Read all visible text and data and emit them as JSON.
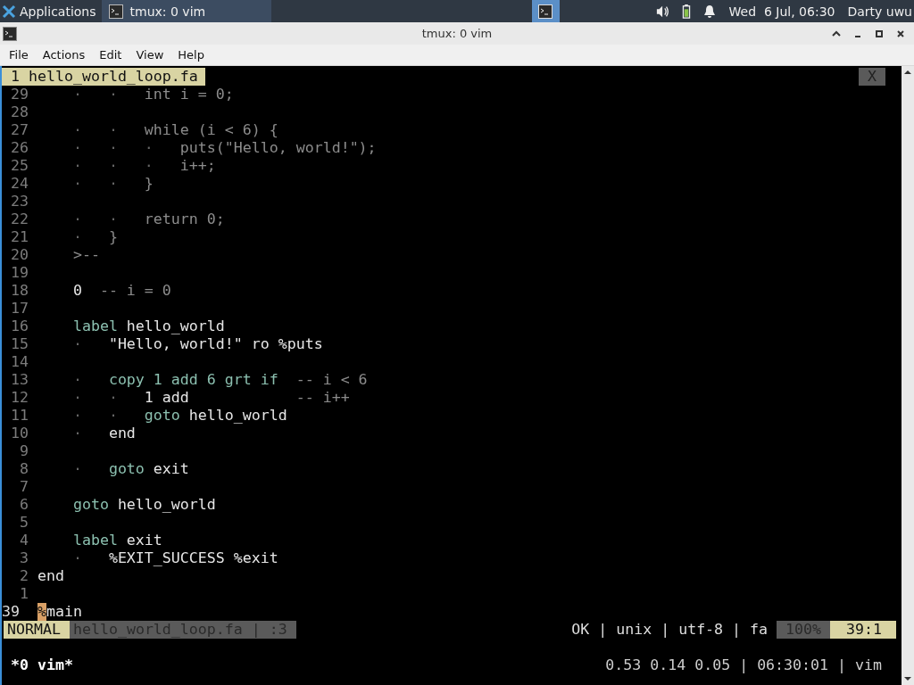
{
  "taskbar": {
    "menu_label": "Applications",
    "tasks": [
      {
        "title": "tmux: 0 vim",
        "selected": true
      }
    ],
    "clock": "Wed  6 Jul, 06:30",
    "user": "Darty uwu"
  },
  "window": {
    "title": "tmux: 0 vim"
  },
  "menu": [
    "File",
    "Actions",
    "Edit",
    "View",
    "Help"
  ],
  "vim": {
    "tabs": [
      {
        "label": "1 hello_world_loop.fa",
        "selected": true
      }
    ],
    "close_label": "X",
    "lines": [
      {
        "number": "29",
        "current": false,
        "segments": [
          {
            "kind": "guide",
            "text": "    ·   ·   "
          },
          {
            "kind": "dim",
            "text": "int i = 0;"
          }
        ]
      },
      {
        "number": "28",
        "current": false
      },
      {
        "number": "27",
        "current": false,
        "segments": [
          {
            "kind": "guide",
            "text": "    ·   ·   "
          },
          {
            "kind": "dim",
            "text": "while (i < 6) {"
          }
        ]
      },
      {
        "number": "26",
        "current": false,
        "segments": [
          {
            "kind": "guide",
            "text": "    ·   ·   ·   "
          },
          {
            "kind": "dim",
            "text": "puts(\"Hello, world!\");"
          }
        ]
      },
      {
        "number": "25",
        "current": false,
        "segments": [
          {
            "kind": "guide",
            "text": "    ·   ·   ·   "
          },
          {
            "kind": "dim",
            "text": "i++;"
          }
        ]
      },
      {
        "number": "24",
        "current": false,
        "segments": [
          {
            "kind": "guide",
            "text": "    ·   ·   "
          },
          {
            "kind": "dim",
            "text": "}"
          }
        ]
      },
      {
        "number": "23",
        "current": false
      },
      {
        "number": "22",
        "current": false,
        "segments": [
          {
            "kind": "guide",
            "text": "    ·   ·   "
          },
          {
            "kind": "dim",
            "text": "return 0;"
          }
        ]
      },
      {
        "number": "21",
        "current": false,
        "segments": [
          {
            "kind": "guide",
            "text": "    ·   "
          },
          {
            "kind": "dim",
            "text": "}"
          }
        ]
      },
      {
        "number": "20",
        "current": false,
        "segments": [
          {
            "kind": "dim",
            "text": "    >--"
          }
        ]
      },
      {
        "number": "19",
        "current": false
      },
      {
        "number": "18",
        "current": false,
        "segments": [
          {
            "kind": "plain",
            "text": "    0  "
          },
          {
            "kind": "dim",
            "text": "-- i = 0"
          }
        ]
      },
      {
        "number": "17",
        "current": false
      },
      {
        "number": "16",
        "current": false,
        "segments": [
          {
            "kind": "keyword",
            "text": "    label "
          },
          {
            "kind": "plain",
            "text": "hello_world"
          }
        ]
      },
      {
        "number": "15",
        "current": false,
        "segments": [
          {
            "kind": "guide",
            "text": "    ·   "
          },
          {
            "kind": "plain",
            "text": "\"Hello, world!\" ro %puts"
          }
        ]
      },
      {
        "number": "14",
        "current": false
      },
      {
        "number": "13",
        "current": false,
        "segments": [
          {
            "kind": "guide",
            "text": "    ·   "
          },
          {
            "kind": "keyword",
            "text": "copy 1 add 6 grt if  "
          },
          {
            "kind": "dim",
            "text": "-- i < 6"
          }
        ]
      },
      {
        "number": "12",
        "current": false,
        "segments": [
          {
            "kind": "guide",
            "text": "    ·   ·   "
          },
          {
            "kind": "plain",
            "text": "1 add            "
          },
          {
            "kind": "dim",
            "text": "-- i++"
          }
        ]
      },
      {
        "number": "11",
        "current": false,
        "segments": [
          {
            "kind": "guide",
            "text": "    ·   ·   "
          },
          {
            "kind": "keyword",
            "text": "goto "
          },
          {
            "kind": "plain",
            "text": "hello_world"
          }
        ]
      },
      {
        "number": "10",
        "current": false,
        "segments": [
          {
            "kind": "guide",
            "text": "    ·   "
          },
          {
            "kind": "plain",
            "text": "end"
          }
        ]
      },
      {
        "number": "9",
        "current": false
      },
      {
        "number": "8",
        "current": false,
        "segments": [
          {
            "kind": "guide",
            "text": "    ·   "
          },
          {
            "kind": "keyword",
            "text": "goto "
          },
          {
            "kind": "plain",
            "text": "exit"
          }
        ]
      },
      {
        "number": "7",
        "current": false
      },
      {
        "number": "6",
        "current": false,
        "segments": [
          {
            "kind": "keyword",
            "text": "    goto "
          },
          {
            "kind": "plain",
            "text": "hello_world"
          }
        ]
      },
      {
        "number": "5",
        "current": false
      },
      {
        "number": "4",
        "current": false,
        "segments": [
          {
            "kind": "keyword",
            "text": "    label "
          },
          {
            "kind": "plain",
            "text": "exit"
          }
        ]
      },
      {
        "number": "3",
        "current": false,
        "segments": [
          {
            "kind": "guide",
            "text": "    ·   "
          },
          {
            "kind": "plain",
            "text": "%EXIT_SUCCESS %exit"
          }
        ]
      },
      {
        "number": "2",
        "current": false,
        "segments": [
          {
            "kind": "plain",
            "text": "end"
          }
        ]
      },
      {
        "number": "1",
        "current": false
      },
      {
        "number": "39",
        "current": true,
        "segments": [
          {
            "kind": "cursor",
            "text": "%"
          },
          {
            "kind": "plain",
            "text": "main"
          }
        ]
      }
    ],
    "statusline": {
      "mode": "NORMAL",
      "file": "hello_world_loop.fa | :3",
      "info": "OK | unix | utf-8 | fa",
      "percent": "100%",
      "position": "39:1"
    }
  },
  "tmux": {
    "window": "*0 vim*",
    "status": "0.53 0.14 0.05 | 06:30:01 | vim"
  }
}
